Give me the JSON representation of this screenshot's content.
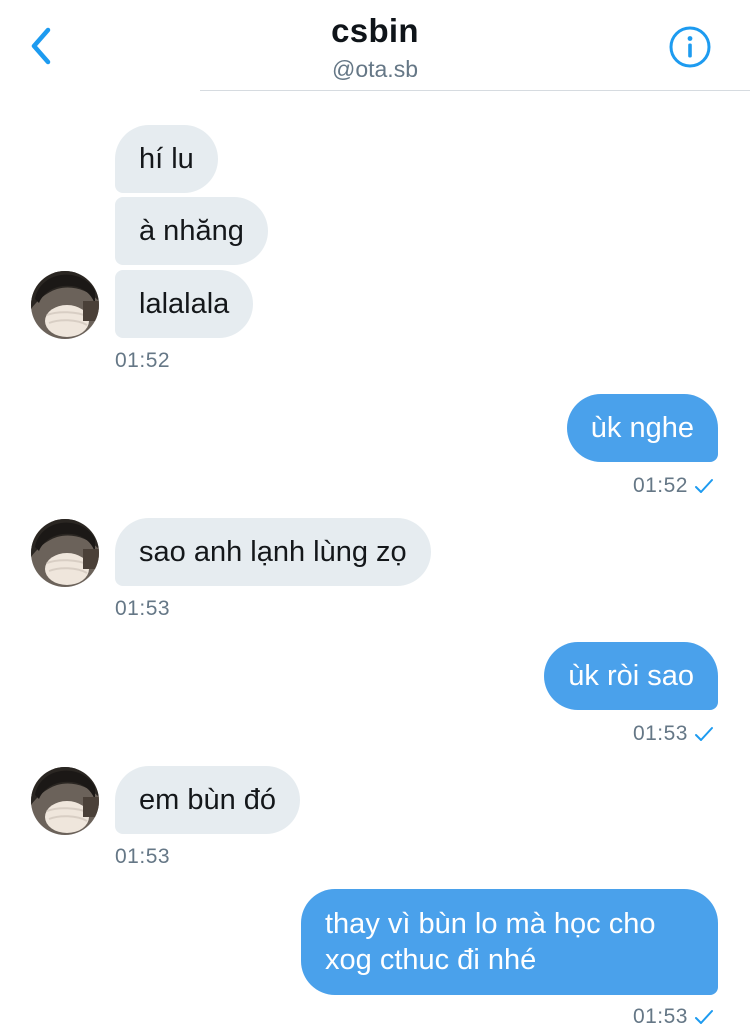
{
  "header": {
    "title": "csbin",
    "handle": "@ota.sb"
  },
  "messages": [
    {
      "from": "them",
      "text": "hí lu"
    },
    {
      "from": "them",
      "text": "à nhăng"
    },
    {
      "from": "them",
      "text": "lalalala",
      "time": "01:52"
    },
    {
      "from": "me",
      "text": "ùk nghe",
      "time": "01:52"
    },
    {
      "from": "them",
      "text": "sao anh lạnh lùng zọ",
      "time": "01:53"
    },
    {
      "from": "me",
      "text": "ùk ròi sao",
      "time": "01:53"
    },
    {
      "from": "them",
      "text": "em bùn đó",
      "time": "01:53"
    },
    {
      "from": "me",
      "text": "thay vì bùn lo mà học cho xog cthuc đi nhé",
      "time": "01:53"
    }
  ],
  "colors": {
    "accent": "#4aa1eb",
    "incoming_bubble": "#e6ecf0",
    "timestamp": "#657786"
  },
  "icons": {
    "back": "chevron-left-icon",
    "info": "info-circle-icon",
    "read": "checkmark-icon"
  }
}
